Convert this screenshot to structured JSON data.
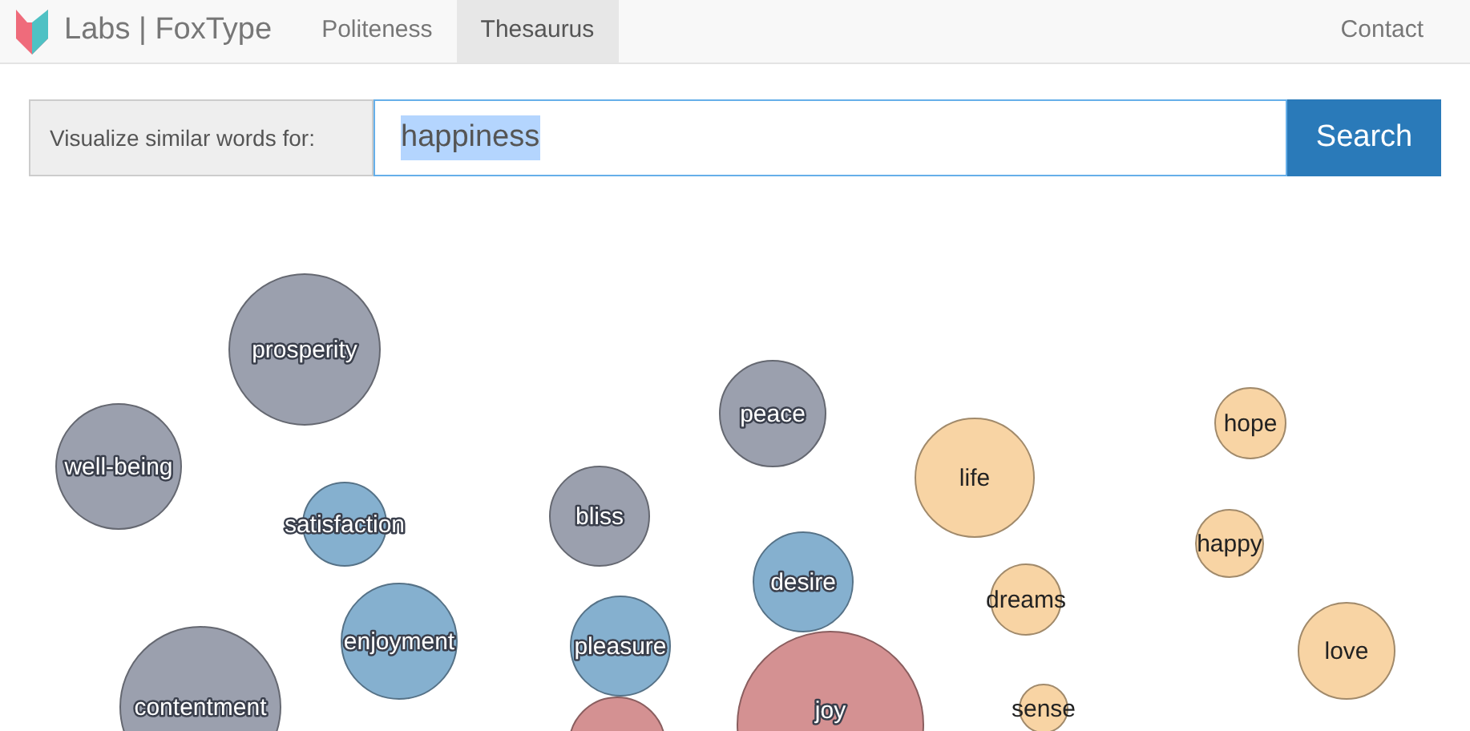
{
  "brand": "Labs | FoxType",
  "nav": [
    {
      "label": "Politeness",
      "selected": false
    },
    {
      "label": "Thesaurus",
      "selected": true
    }
  ],
  "contact": "Contact",
  "search": {
    "label": "Visualize similar words for:",
    "value": "happiness",
    "button": "Search"
  },
  "bubbles": [
    {
      "word": "prosperity",
      "color": "#9ba0ae"
    },
    {
      "word": "peace",
      "color": "#9ba0ae"
    },
    {
      "word": "hope",
      "color": "#f8d4a4"
    },
    {
      "word": "well-being",
      "color": "#9ba0ae"
    },
    {
      "word": "life",
      "color": "#f8d4a4"
    },
    {
      "word": "bliss",
      "color": "#9ba0ae"
    },
    {
      "word": "satisfaction",
      "color": "#85b0cf"
    },
    {
      "word": "happy",
      "color": "#f8d4a4"
    },
    {
      "word": "desire",
      "color": "#85b0cf"
    },
    {
      "word": "dreams",
      "color": "#f8d4a4"
    },
    {
      "word": "enjoyment",
      "color": "#85b0cf"
    },
    {
      "word": "pleasure",
      "color": "#85b0cf"
    },
    {
      "word": "love",
      "color": "#f8d4a4"
    },
    {
      "word": "contentment",
      "color": "#9ba0ae"
    },
    {
      "word": "joy",
      "color": "#d49192"
    },
    {
      "word": "sense",
      "color": "#f8d4a4"
    },
    {
      "color": "#d49192"
    }
  ]
}
